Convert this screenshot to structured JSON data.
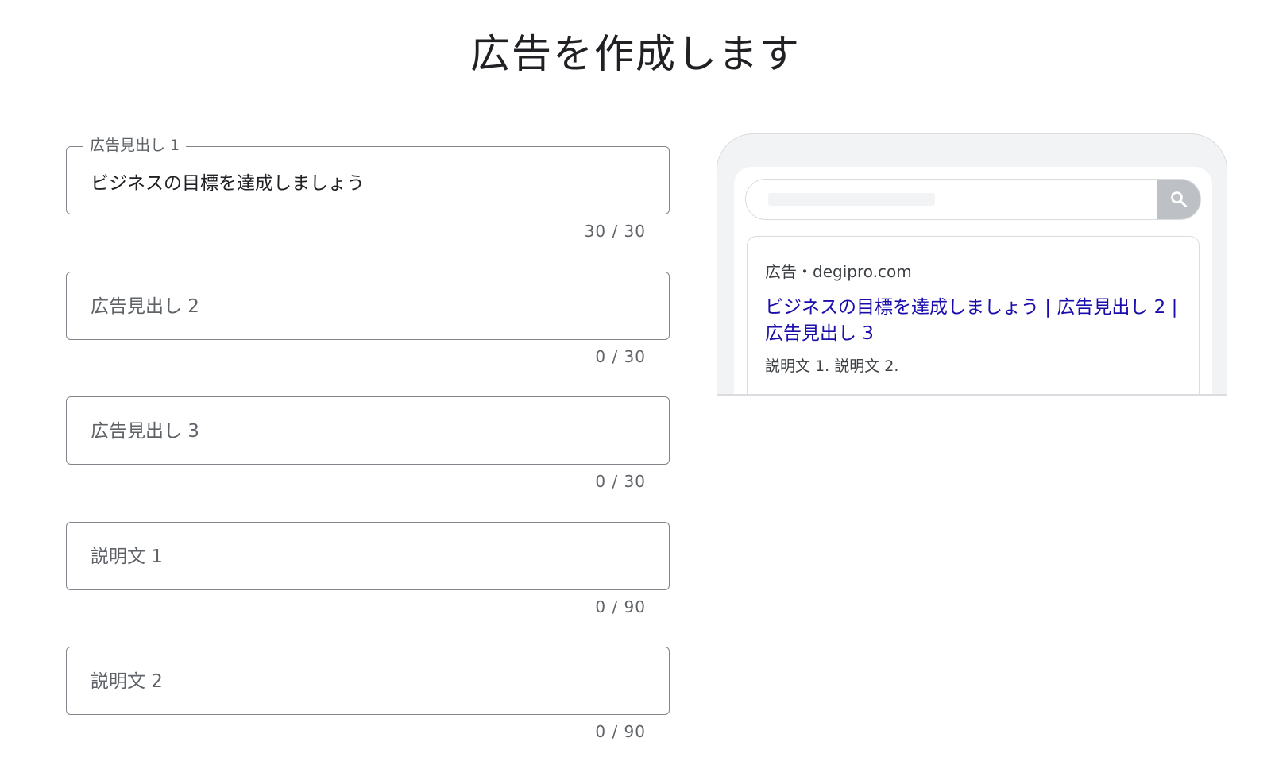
{
  "page": {
    "title": "広告を作成します"
  },
  "form": {
    "fields": [
      {
        "label": "広告見出し 1",
        "value": "ビジネスの目標を達成しましょう",
        "placeholder": "",
        "counter": "30 / 30"
      },
      {
        "label": "",
        "value": "",
        "placeholder": "広告見出し 2",
        "counter": "0 / 30"
      },
      {
        "label": "",
        "value": "",
        "placeholder": "広告見出し 3",
        "counter": "0 / 30"
      },
      {
        "label": "",
        "value": "",
        "placeholder": "説明文 1",
        "counter": "0 / 90"
      },
      {
        "label": "",
        "value": "",
        "placeholder": "説明文 2",
        "counter": "0 / 90"
      }
    ]
  },
  "preview": {
    "search_icon": "search-icon",
    "ad_meta": "広告・degipro.com",
    "ad_headline": "ビジネスの目標を達成しましょう | 広告見出し 2 | 広告見出し 3",
    "ad_description": "説明文 1. 説明文 2."
  },
  "colors": {
    "headline_link": "#1a0dab",
    "search_button": "#bdc1c6",
    "phone_frame": "#f1f3f4",
    "border": "#80868b"
  }
}
